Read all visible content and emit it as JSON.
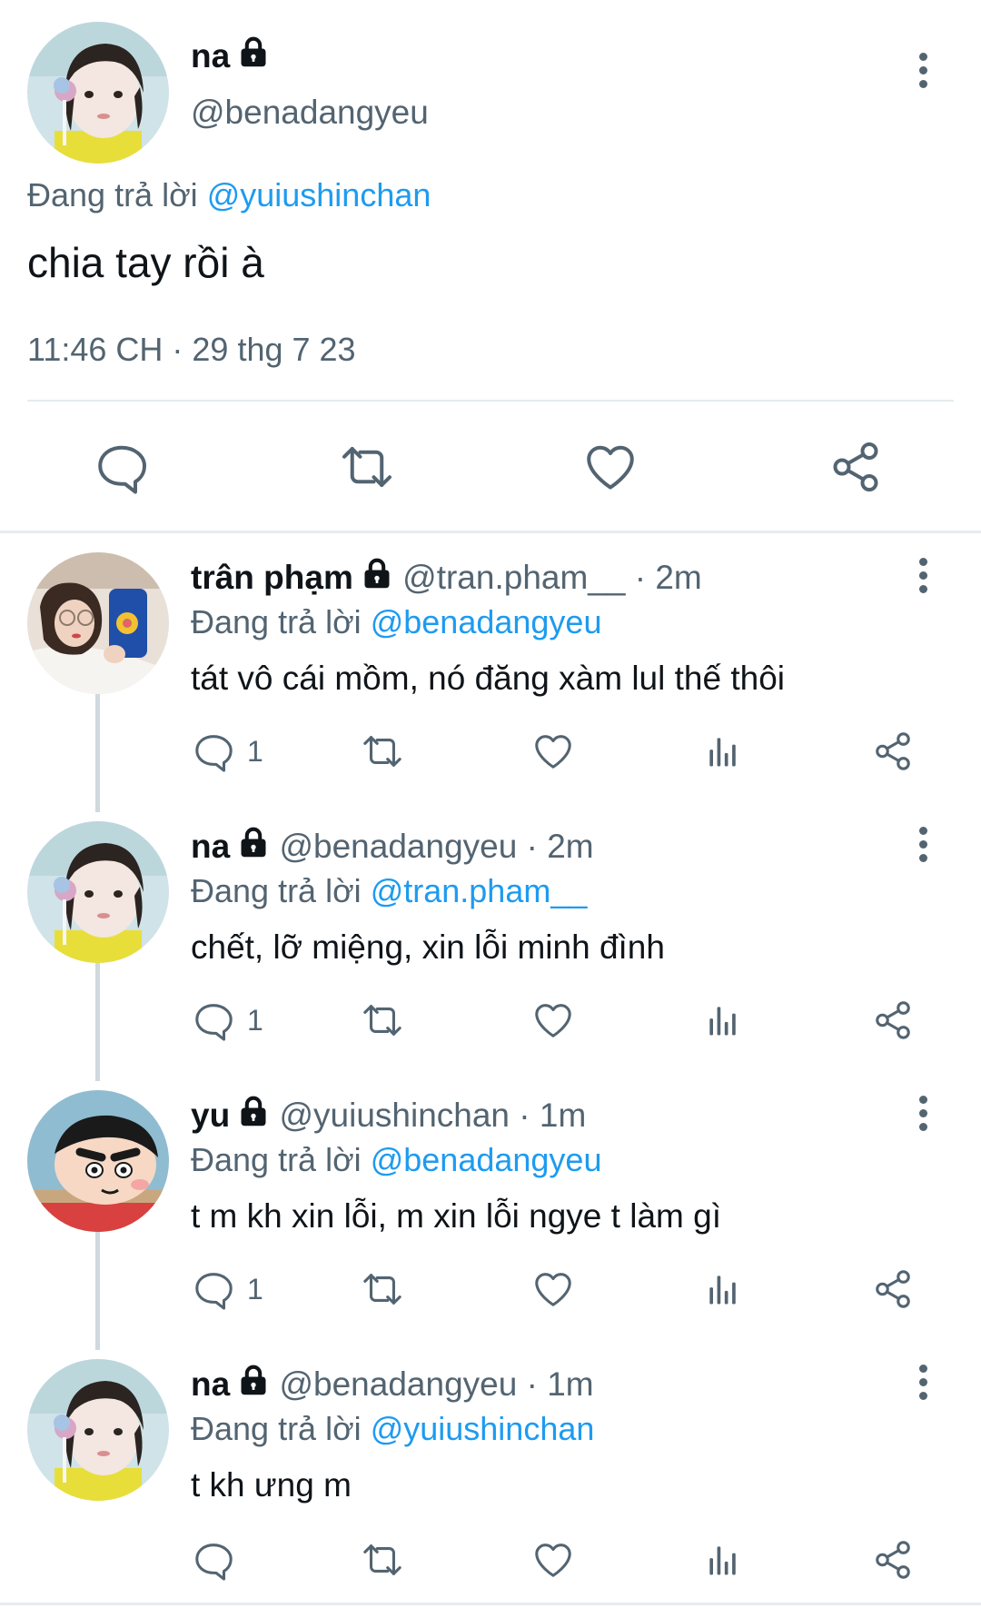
{
  "main_tweet": {
    "author_name": "na",
    "author_handle": "@benadangyeu",
    "replying_prefix": "Đang trả lời",
    "replying_to": "@yuiushinchan",
    "text": "chia tay rồi à",
    "timestamp": "11:46 CH · 29 thg 7 23"
  },
  "replies": [
    {
      "name": "trân phạm",
      "handle": "@tran.pham__",
      "time": "· 2m",
      "replying_prefix": "Đang trả lời",
      "replying_to": "@benadangyeu",
      "text": "tát vô cái mồm, nó đăng xàm lul thế thôi",
      "reply_count": "1"
    },
    {
      "name": "na",
      "handle": "@benadangyeu",
      "time": "· 2m",
      "replying_prefix": "Đang trả lời",
      "replying_to": "@tran.pham__",
      "text": "chết, lỡ miệng, xin lỗi minh đình",
      "reply_count": "1"
    },
    {
      "name": "yu",
      "handle": "@yuiushinchan",
      "time": "· 1m",
      "replying_prefix": "Đang trả lời",
      "replying_to": "@benadangyeu",
      "text": "t m kh xin lỗi, m xin lỗi ngye t làm gì",
      "reply_count": "1"
    },
    {
      "name": "na",
      "handle": "@benadangyeu",
      "time": "· 1m",
      "replying_prefix": "Đang trả lời",
      "replying_to": "@yuiushinchan",
      "text": "t kh ưng m",
      "reply_count": ""
    }
  ],
  "icons": {
    "reply": "speech-bubble-icon",
    "retweet": "retweet-icon",
    "like": "heart-icon",
    "views": "bar-chart-icon",
    "share": "share-icon",
    "more": "more-vertical-icon",
    "protected": "lock-icon"
  },
  "colors": {
    "accent": "#1d9bf0",
    "secondary_text": "#536471",
    "primary_text": "#0f1419",
    "divider": "#e6ecf0"
  }
}
